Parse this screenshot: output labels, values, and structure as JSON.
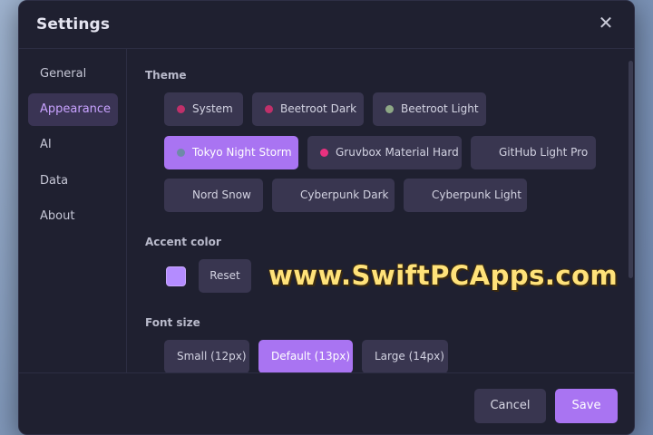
{
  "dialog": {
    "title": "Settings",
    "close_icon": "close-icon"
  },
  "sidebar": {
    "items": [
      {
        "label": "General",
        "active": false
      },
      {
        "label": "Appearance",
        "active": true
      },
      {
        "label": "AI",
        "active": false
      },
      {
        "label": "Data",
        "active": false
      },
      {
        "label": "About",
        "active": false
      }
    ]
  },
  "theme": {
    "label": "Theme",
    "options": [
      {
        "label": "System",
        "dot_color": "#c0306a",
        "selected": false
      },
      {
        "label": "Beetroot Dark",
        "dot_color": "#c0306a",
        "selected": false
      },
      {
        "label": "Beetroot Light",
        "dot_color": "#c0306a",
        "selected": false
      },
      {
        "label": "Tokyo Night Storm",
        "dot_color": "#7aa2f7",
        "selected": true
      },
      {
        "label": "Gruvbox Material Hard",
        "dot_color": "#8ea886",
        "selected": false
      },
      {
        "label": "GitHub Light Pro",
        "dot_color": "#2f6fd1",
        "selected": false
      },
      {
        "label": "Nord Snow",
        "dot_color": "#6e8aa8",
        "selected": false
      },
      {
        "label": "Cyberpunk Dark",
        "dot_color": "#1ad6f0",
        "selected": false
      },
      {
        "label": "Cyberpunk Light",
        "dot_color": "#e8317f",
        "selected": false
      }
    ]
  },
  "accent": {
    "label": "Accent color",
    "color": "#b48cff",
    "reset_label": "Reset"
  },
  "font_size": {
    "label": "Font size",
    "options": [
      {
        "label": "Small (12px)",
        "selected": false
      },
      {
        "label": "Default (13px)",
        "selected": true
      },
      {
        "label": "Large (14px)",
        "selected": false
      }
    ]
  },
  "footer": {
    "cancel_label": "Cancel",
    "save_label": "Save"
  },
  "watermark": "www.SwiftPCApps.com"
}
